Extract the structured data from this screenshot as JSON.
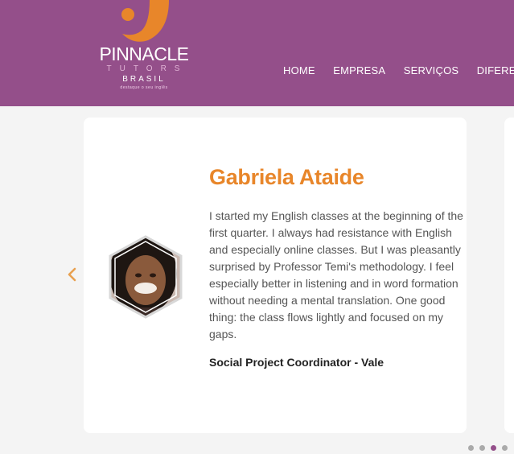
{
  "brand": {
    "name": "PINNACLE",
    "sub1": "TUTORS",
    "sub2": "BRASIL",
    "tagline": "destaque o seu inglês"
  },
  "nav": {
    "items": [
      "HOME",
      "EMPRESA",
      "SERVIÇOS",
      "DIFERENC"
    ]
  },
  "testimonial": {
    "name": "Gabriela Ataide",
    "quote": "I started my English classes at the beginning of the first quarter. I always had resistance with English and especially online classes. But I was pleasantly surprised by Professor Temi's methodology. I feel especially better in listening and in word formation without needing a mental translation. One good thing: the class flows lightly and focused on my gaps.",
    "role": "Social Project Coordinator - Vale"
  },
  "carousel": {
    "prev_icon": "chevron-left-icon",
    "dot_count": 4,
    "active_dot_index": 2
  },
  "colors": {
    "header_bg": "#944f8a",
    "accent_orange": "#e8862a",
    "text_gray": "#555555"
  }
}
